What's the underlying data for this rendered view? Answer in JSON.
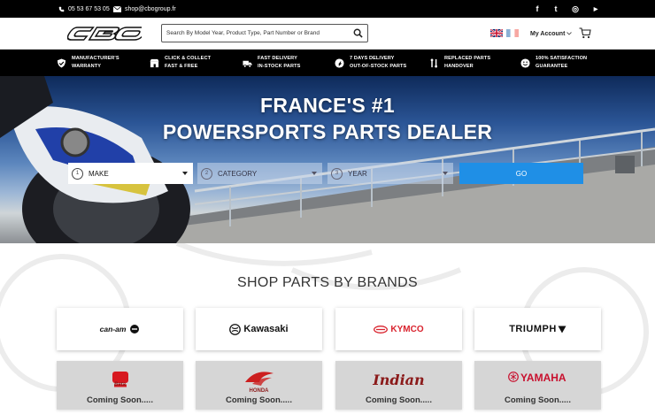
{
  "topbar": {
    "phone": "05 53 67 53 05",
    "email": "shop@cbogroup.fr",
    "social": [
      {
        "icon": "facebook-icon",
        "glyph": "f"
      },
      {
        "icon": "twitter-icon",
        "glyph": "t"
      },
      {
        "icon": "instagram-icon",
        "glyph": "◎"
      },
      {
        "icon": "youtube-icon",
        "glyph": "▶"
      }
    ]
  },
  "header": {
    "logo_text": "CBO",
    "search_placeholder": "Search By Model Year, Product Type, Part Number or Brand",
    "languages": [
      "English",
      "Français"
    ],
    "account_label": "My Account"
  },
  "features": [
    {
      "icon": "shield-check-icon",
      "line1": "MANUFACTURER'S",
      "line2": "WARRANTY"
    },
    {
      "icon": "store-icon",
      "line1": "CLICK & COLLECT",
      "line2": "FAST & FREE"
    },
    {
      "icon": "truck-icon",
      "line1": "FAST DELIVERY",
      "line2": "IN-STOCK PARTS"
    },
    {
      "icon": "rocket-icon",
      "line1": "7 DAYS DELIVERY",
      "line2": "OUT-OF-STOCK PARTS"
    },
    {
      "icon": "wrench-icon",
      "line1": "REPLACED PARTS",
      "line2": "HANDOVER"
    },
    {
      "icon": "smiley-icon",
      "line1": "100% SATISFACTION",
      "line2": "GUARANTEE"
    }
  ],
  "hero": {
    "title_line1": "FRANCE'S #1",
    "title_line2": "POWERSPORTS PARTS DEALER",
    "selects": [
      {
        "num": "1",
        "label": "MAKE"
      },
      {
        "num": "2",
        "label": "CATEGORY"
      },
      {
        "num": "3",
        "label": "YEAR"
      }
    ],
    "go_label": "GO"
  },
  "brands": {
    "title": "SHOP PARTS BY BRANDS",
    "available": [
      {
        "name": "can-am",
        "text": "can-am"
      },
      {
        "name": "kawasaki",
        "text": "Kawasaki"
      },
      {
        "name": "kymco",
        "text": "KYMCO"
      },
      {
        "name": "triumph",
        "text": "TRIUMPH"
      }
    ],
    "coming": [
      {
        "name": "beta",
        "text": "Beta"
      },
      {
        "name": "honda",
        "text": "HONDA"
      },
      {
        "name": "indian",
        "text": "Indian"
      },
      {
        "name": "yamaha",
        "text": "YAMAHA"
      }
    ],
    "coming_soon_label": "Coming Soon....."
  },
  "colors": {
    "accent": "#1f8fe6",
    "black": "#000000",
    "kymco_red": "#d9232e",
    "honda_red": "#cc1f1f",
    "yamaha_red": "#c8102e"
  }
}
